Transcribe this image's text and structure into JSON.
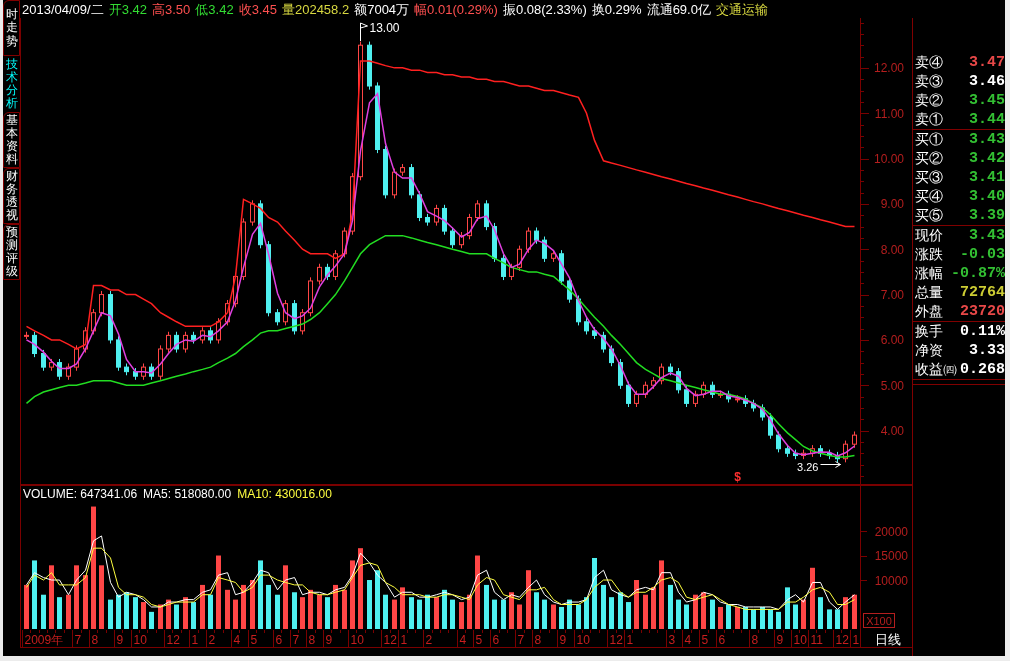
{
  "sidebar_tabs": [
    {
      "label": "时走势",
      "selected": false
    },
    {
      "label": "技术分析",
      "selected": true
    },
    {
      "label": "基本资料",
      "selected": false
    },
    {
      "label": "财务透视",
      "selected": false
    },
    {
      "label": "预测评级",
      "selected": false
    }
  ],
  "quote_bar": [
    {
      "text": "2013/04/09/二",
      "color": "#ffffff"
    },
    {
      "text": "开3.42",
      "color": "#33dd33"
    },
    {
      "text": "高3.50",
      "color": "#ff5050"
    },
    {
      "text": "低3.42",
      "color": "#33dd33"
    },
    {
      "text": "收3.45",
      "color": "#ff5050"
    },
    {
      "text": "量202458.2",
      "color": "#d8d840"
    },
    {
      "text": "额7004万",
      "color": "#ffffff"
    },
    {
      "text": "幅0.01(0.29%)",
      "color": "#ff5050"
    },
    {
      "text": "振0.08(2.33%)",
      "color": "#ffffff"
    },
    {
      "text": "换0.29%",
      "color": "#ffffff"
    },
    {
      "text": "流通69.0亿",
      "color": "#ffffff"
    },
    {
      "text": "交通运输",
      "color": "#d8d840"
    }
  ],
  "main_chart": {
    "marker": "$",
    "chart_data": {
      "type": "line",
      "ylim": [
        2.8,
        13.1
      ],
      "yticks": [
        {
          "value": 4,
          "label": "4.00"
        },
        {
          "value": 5,
          "label": "5.00"
        },
        {
          "value": 6,
          "label": "6.00"
        },
        {
          "value": 7,
          "label": "7.00"
        },
        {
          "value": 8,
          "label": "8.00"
        },
        {
          "value": 9,
          "label": "9.00"
        },
        {
          "value": 10,
          "label": "10.00"
        },
        {
          "value": 11,
          "label": "11.00"
        },
        {
          "value": 12,
          "label": "12.00"
        }
      ],
      "series": [
        {
          "color": "#ff2020",
          "values": [
            6.3,
            6.2,
            6.1,
            6.0,
            6.0,
            5.9,
            5.8,
            5.9,
            7.2,
            7.2,
            7.1,
            7.1,
            7.0,
            7.0,
            6.9,
            6.8,
            6.6,
            6.5,
            6.4,
            6.3,
            6.3,
            6.3,
            6.3,
            6.4,
            6.6,
            7.4,
            9.1,
            9.0,
            8.9,
            8.7,
            8.6,
            8.4,
            8.2,
            8.0,
            7.9,
            7.9,
            7.9,
            7.8,
            7.9,
            8.8,
            12.15,
            12.15,
            12.1,
            12.05,
            12.0,
            12.0,
            11.95,
            11.95,
            11.9,
            11.9,
            11.85,
            11.85,
            11.8,
            11.8,
            11.75,
            11.75,
            11.7,
            11.7,
            11.65,
            11.6,
            11.6,
            11.55,
            11.5,
            11.5,
            11.45,
            11.4,
            11.35,
            11.0,
            10.4,
            9.95,
            9.9,
            9.85,
            9.8,
            9.75,
            9.7,
            9.65,
            9.6,
            9.55,
            9.5,
            9.45,
            9.4,
            9.35,
            9.3,
            9.25,
            9.2,
            9.15,
            9.1,
            9.05,
            9.0,
            8.95,
            8.9,
            8.85,
            8.8,
            8.75,
            8.7,
            8.65,
            8.6,
            8.55,
            8.5,
            8.5
          ]
        },
        {
          "color": "#22dd22",
          "values": [
            4.6,
            4.75,
            4.85,
            4.9,
            4.95,
            5.0,
            5.0,
            5.05,
            5.1,
            5.1,
            5.1,
            5.05,
            5.0,
            5.0,
            5.0,
            5.05,
            5.1,
            5.15,
            5.2,
            5.25,
            5.3,
            5.35,
            5.4,
            5.5,
            5.6,
            5.7,
            5.85,
            6.0,
            6.15,
            6.2,
            6.2,
            6.25,
            6.3,
            6.35,
            6.45,
            6.6,
            6.8,
            7.0,
            7.3,
            7.6,
            7.9,
            8.1,
            8.2,
            8.3,
            8.3,
            8.3,
            8.25,
            8.2,
            8.15,
            8.1,
            8.05,
            8.0,
            7.95,
            7.9,
            7.9,
            7.9,
            7.8,
            7.7,
            7.6,
            7.55,
            7.5,
            7.5,
            7.45,
            7.4,
            7.25,
            7.1,
            6.9,
            6.7,
            6.5,
            6.3,
            6.1,
            5.9,
            5.7,
            5.5,
            5.35,
            5.25,
            5.15,
            5.1,
            5.05,
            5.0,
            4.95,
            4.9,
            4.85,
            4.8,
            4.8,
            4.75,
            4.7,
            4.6,
            4.5,
            4.35,
            4.15,
            3.95,
            3.8,
            3.65,
            3.55,
            3.5,
            3.45,
            3.42,
            3.42,
            3.45
          ]
        },
        {
          "color": "#e040e0",
          "values": [
            6.0,
            5.9,
            5.73,
            5.53,
            5.37,
            5.37,
            5.47,
            5.8,
            6.2,
            6.6,
            6.53,
            6.13,
            5.57,
            5.3,
            5.3,
            5.27,
            5.47,
            5.7,
            5.9,
            6.0,
            5.97,
            6.1,
            6.07,
            6.2,
            6.4,
            6.87,
            7.6,
            8.33,
            8.57,
            7.9,
            7.03,
            6.6,
            6.47,
            6.53,
            6.7,
            7.17,
            7.43,
            7.63,
            7.9,
            8.63,
            10.17,
            11.23,
            11.43,
            10.33,
            9.7,
            9.57,
            9.57,
            9.23,
            8.83,
            8.73,
            8.63,
            8.47,
            8.27,
            8.37,
            8.67,
            8.73,
            8.43,
            7.9,
            7.6,
            7.67,
            8.0,
            8.2,
            8.13,
            7.97,
            7.67,
            7.37,
            6.87,
            6.5,
            6.23,
            6.03,
            5.8,
            5.43,
            5.03,
            4.8,
            4.8,
            4.97,
            5.17,
            5.27,
            5.2,
            4.93,
            4.77,
            4.8,
            4.87,
            4.87,
            4.77,
            4.73,
            4.67,
            4.6,
            4.47,
            4.23,
            3.93,
            3.67,
            3.5,
            3.47,
            3.5,
            3.53,
            3.52,
            3.44,
            3.51,
            3.66
          ]
        }
      ],
      "annotations": [
        "13.00",
        "3.26"
      ]
    }
  },
  "volume": {
    "legend": [
      {
        "text": "VOLUME: 647341.06",
        "color": "#ffffff"
      },
      {
        "text": "MA5: 518080.00",
        "color": "#ffffff"
      },
      {
        "text": "MA10: 430016.00",
        "color": "#ffff40"
      }
    ],
    "multiplier": "X100",
    "time_axis": [
      "2009年",
      "7",
      "8",
      "9",
      "10",
      "12",
      "1",
      "2",
      "4",
      "5",
      "6",
      "7",
      "8",
      "9",
      "10",
      "12",
      "1",
      "2",
      "4",
      "5",
      "6",
      "7",
      "8",
      "9",
      "10",
      "12",
      "1",
      "3",
      "4",
      "5",
      "6",
      "8",
      "9",
      "10",
      "11",
      "12",
      "1"
    ],
    "period": "日线",
    "chart_data": {
      "type": "bar",
      "ylim": [
        0,
        29400
      ],
      "yticks": [
        10000,
        15000,
        20000
      ],
      "series": [
        {
          "values": [
            9000,
            14000,
            7000,
            13000,
            6500,
            7000,
            13000,
            11000,
            25000,
            13000,
            6000,
            7000,
            7500,
            6500,
            5500,
            3500,
            5000,
            6000,
            5000,
            6500,
            5500,
            9000,
            7000,
            15000,
            8000,
            6000,
            9000,
            10000,
            14000,
            9000,
            7000,
            13000,
            7500,
            6500,
            8000,
            7000,
            6500,
            9000,
            8000,
            14000,
            16500,
            10000,
            12000,
            7000,
            6000,
            8500,
            6500,
            6000,
            7000,
            6500,
            8000,
            6000,
            5500,
            7000,
            15000,
            9000,
            6000,
            6000,
            7500,
            5000,
            12000,
            7500,
            6000,
            5000,
            4500,
            6000,
            5000,
            6500,
            14500,
            9000,
            6500,
            7500,
            5500,
            10000,
            7000,
            8500,
            14000,
            9000,
            6000,
            5000,
            7000,
            7500,
            6000,
            4500,
            5000,
            4500,
            4500,
            4000,
            4500,
            4000,
            3500,
            8500,
            5000,
            6000,
            12500,
            6500,
            4000,
            4000,
            6500,
            7000
          ],
          "colors": [
            "#ff4646",
            "#4ff0f0",
            "#4ff0f0",
            "#ff4646",
            "#4ff0f0",
            "#ff4646",
            "#ff4646",
            "#ff4646",
            "#ff4646",
            "#ff4646",
            "#4ff0f0",
            "#4ff0f0",
            "#4ff0f0",
            "#4ff0f0",
            "#ff4646",
            "#4ff0f0",
            "#ff4646",
            "#ff4646",
            "#4ff0f0",
            "#ff4646",
            "#4ff0f0",
            "#ff4646",
            "#4ff0f0",
            "#ff4646",
            "#ff4646",
            "#ff4646",
            "#ff4646",
            "#ff4646",
            "#4ff0f0",
            "#4ff0f0",
            "#4ff0f0",
            "#ff4646",
            "#4ff0f0",
            "#ff4646",
            "#ff4646",
            "#ff4646",
            "#4ff0f0",
            "#ff4646",
            "#ff4646",
            "#ff4646",
            "#ff4646",
            "#4ff0f0",
            "#4ff0f0",
            "#4ff0f0",
            "#ff4646",
            "#ff4646",
            "#4ff0f0",
            "#4ff0f0",
            "#4ff0f0",
            "#ff4646",
            "#4ff0f0",
            "#4ff0f0",
            "#ff4646",
            "#ff4646",
            "#ff4646",
            "#4ff0f0",
            "#4ff0f0",
            "#4ff0f0",
            "#ff4646",
            "#ff4646",
            "#ff4646",
            "#4ff0f0",
            "#4ff0f0",
            "#ff4646",
            "#4ff0f0",
            "#4ff0f0",
            "#4ff0f0",
            "#4ff0f0",
            "#4ff0f0",
            "#4ff0f0",
            "#4ff0f0",
            "#4ff0f0",
            "#4ff0f0",
            "#ff4646",
            "#ff4646",
            "#ff4646",
            "#ff4646",
            "#4ff0f0",
            "#4ff0f0",
            "#4ff0f0",
            "#ff4646",
            "#ff4646",
            "#4ff0f0",
            "#ff4646",
            "#4ff0f0",
            "#ff4646",
            "#4ff0f0",
            "#4ff0f0",
            "#4ff0f0",
            "#4ff0f0",
            "#4ff0f0",
            "#4ff0f0",
            "#4ff0f0",
            "#ff4646",
            "#ff4646",
            "#4ff0f0",
            "#4ff0f0",
            "#4ff0f0",
            "#ff4646",
            "#ff4646"
          ]
        },
        {
          "type": "line",
          "color": "#ffffff",
          "values": [
            9000,
            11500,
            10500,
            10000,
            10000,
            7000,
            10000,
            12000,
            18000,
            19000,
            9500,
            6500,
            7500,
            7000,
            6000,
            4500,
            4500,
            5500,
            5500,
            6000,
            6000,
            7500,
            8000,
            11000,
            11500,
            7000,
            7500,
            9500,
            12000,
            11500,
            8000,
            10000,
            10500,
            7000,
            7500,
            7500,
            7000,
            8000,
            8500,
            11000,
            15500,
            13500,
            11000,
            9500,
            6500,
            7500,
            7500,
            6500,
            6500,
            7000,
            7500,
            7000,
            6000,
            6500,
            11000,
            12000,
            7500,
            6000,
            7000,
            6500,
            8500,
            10000,
            7000,
            5500,
            5000,
            5500,
            5500,
            6000,
            10500,
            12000,
            8000,
            7000,
            6500,
            8000,
            8500,
            8000,
            11500,
            11500,
            7500,
            5500,
            6000,
            7500,
            7000,
            5500,
            5000,
            5000,
            4500,
            4500,
            4500,
            4500,
            4000,
            6000,
            7000,
            5500,
            9500,
            9500,
            5500,
            4000,
            5500,
            7000
          ]
        },
        {
          "type": "line",
          "color": "#ffff40",
          "values": [
            8500,
            11000,
            10000,
            11500,
            9000,
            9000,
            9000,
            10500,
            16500,
            16500,
            14500,
            8500,
            7000,
            7000,
            6500,
            5000,
            4500,
            5000,
            5500,
            5500,
            5500,
            7000,
            7000,
            10500,
            10000,
            9500,
            7500,
            8500,
            11000,
            11000,
            10000,
            9500,
            9000,
            9000,
            7500,
            7000,
            7000,
            7500,
            8000,
            10500,
            13000,
            13500,
            13000,
            9500,
            8500,
            7000,
            7000,
            7000,
            6500,
            6500,
            7000,
            7000,
            6500,
            6000,
            9000,
            10500,
            10000,
            7000,
            6500,
            6000,
            8000,
            8000,
            8500,
            6000,
            5000,
            5000,
            5000,
            6000,
            8500,
            10000,
            10000,
            7500,
            6500,
            7500,
            7500,
            8500,
            10000,
            10500,
            9500,
            6500,
            6000,
            6500,
            7000,
            6000,
            5000,
            4500,
            4000,
            4000,
            4000,
            4000,
            4000,
            5500,
            5500,
            6500,
            8000,
            8500,
            7500,
            5000,
            5000,
            6000
          ]
        }
      ]
    }
  },
  "order_book": {
    "asks": [
      {
        "label": "卖④",
        "value": "3.47",
        "color": "#e84848"
      },
      {
        "label": "卖③",
        "value": "3.46",
        "color": "#ffffff"
      },
      {
        "label": "卖②",
        "value": "3.45",
        "color": "#33c033"
      },
      {
        "label": "卖①",
        "value": "3.44",
        "color": "#33c033"
      }
    ],
    "bids": [
      {
        "label": "买①",
        "value": "3.43",
        "color": "#33c033"
      },
      {
        "label": "买②",
        "value": "3.42",
        "color": "#33c033"
      },
      {
        "label": "买③",
        "value": "3.41",
        "color": "#33c033"
      },
      {
        "label": "买④",
        "value": "3.40",
        "color": "#33c033"
      },
      {
        "label": "买⑤",
        "value": "3.39",
        "color": "#33c033"
      }
    ]
  },
  "quote": [
    {
      "label": "现价",
      "value": "3.43",
      "color": "#33c033"
    },
    {
      "label": "涨跌",
      "value": "-0.03",
      "color": "#33c033"
    },
    {
      "label": "涨幅",
      "value": "-0.87%",
      "color": "#33c033"
    },
    {
      "label": "总量",
      "value": "72764",
      "color": "#cccc33"
    },
    {
      "label": "外盘",
      "value": "23720",
      "color": "#e84848"
    }
  ],
  "finance": [
    {
      "label": "换手",
      "value": "0.11%",
      "color": "#ffffff"
    },
    {
      "label": "净资",
      "value": "3.33",
      "color": "#ffffff"
    },
    {
      "label": "收益㈣",
      "value": "0.268",
      "color": "#ffffff"
    }
  ]
}
